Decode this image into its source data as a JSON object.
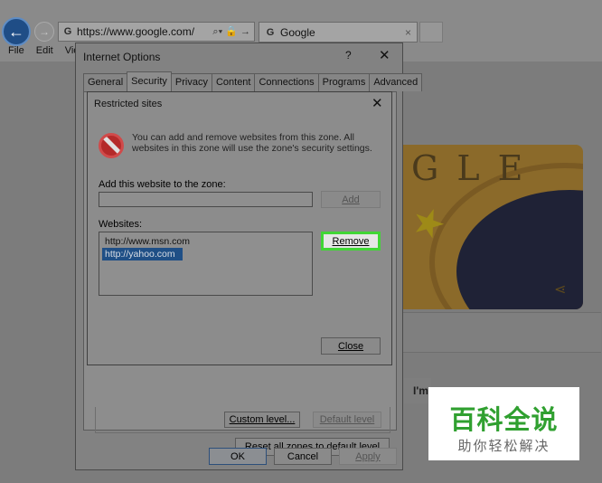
{
  "browser": {
    "address": "https://www.google.com/",
    "tab_title": "Google",
    "tab_close": "×",
    "back_glyph": "←",
    "forward_glyph": "→",
    "addr_icons": "⌕▾ 🔒 →",
    "menu": [
      "File",
      "Edit",
      "Vie"
    ]
  },
  "page_behind": {
    "doodle_letters": "GLE",
    "share_glyph": "⋖",
    "lucky_text": "I'm"
  },
  "internet_options": {
    "title": "Internet Options",
    "help": "?",
    "close": "✕",
    "tabs": [
      "General",
      "Security",
      "Privacy",
      "Content",
      "Connections",
      "Programs",
      "Advanced"
    ],
    "active_tab": "Security",
    "custom_level": "Custom level...",
    "default_level": "Default level",
    "reset_all": "Reset all zones to default level",
    "ok": "OK",
    "cancel": "Cancel",
    "apply": "Apply"
  },
  "restricted_sites": {
    "title": "Restricted sites",
    "close": "✕",
    "description": "You can add and remove websites from this zone. All websites in this zone will use the zone's security settings.",
    "add_label": "Add this website to the zone:",
    "add_value": "",
    "add_button": "Add",
    "websites_label": "Websites:",
    "websites": [
      "http://www.msn.com",
      "http://yahoo.com"
    ],
    "selected_website": "http://yahoo.com",
    "remove_button": "Remove",
    "close_button": "Close",
    "highlight_color": "#41d636"
  },
  "watermark": {
    "brand": "百科全说",
    "slogan": "助你轻松解决"
  }
}
